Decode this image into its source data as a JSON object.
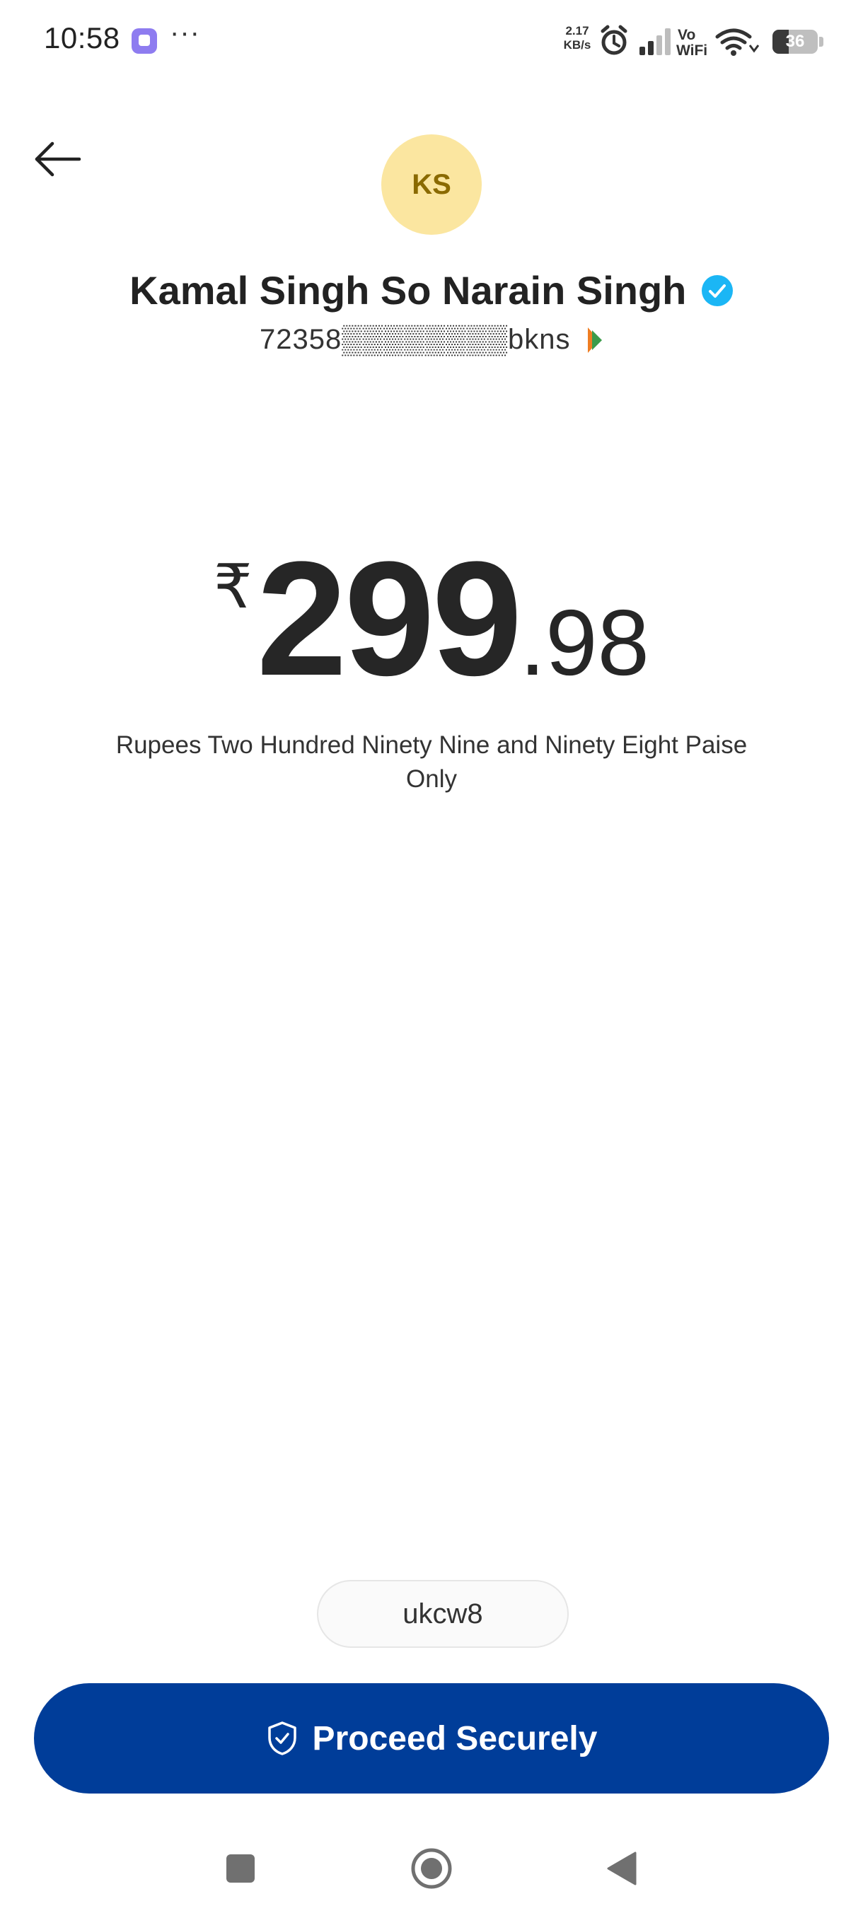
{
  "status_bar": {
    "time": "10:58",
    "more": "···",
    "net_speed_value": "2.17",
    "net_speed_unit": "KB/s",
    "vowifi_top": "Vo",
    "vowifi_bottom": "WiFi",
    "battery_level": "36"
  },
  "payee": {
    "initials": "KS",
    "name": "Kamal Singh So Narain Singh",
    "upi_id": "72358▒▒▒▒▒▒▒▒bkns"
  },
  "amount": {
    "currency": "₹",
    "rupees": "299",
    "paise": ".98",
    "in_words": "Rupees Two Hundred Ninety Nine and Ninety Eight Paise Only"
  },
  "note": {
    "text": "ukcw8"
  },
  "actions": {
    "proceed_label": "Proceed Securely"
  },
  "colors": {
    "primary_button": "#003d99",
    "avatar_bg": "#fbe6a0",
    "avatar_text": "#8a6a00",
    "verified_badge": "#1bb6f5"
  },
  "icons": {
    "back": "arrow-left-icon",
    "verified": "check-badge-icon",
    "upi": "upi-logo-icon",
    "proceed": "shield-check-icon",
    "nav_recent": "square-icon",
    "nav_home": "circle-icon",
    "nav_back": "triangle-back-icon"
  }
}
